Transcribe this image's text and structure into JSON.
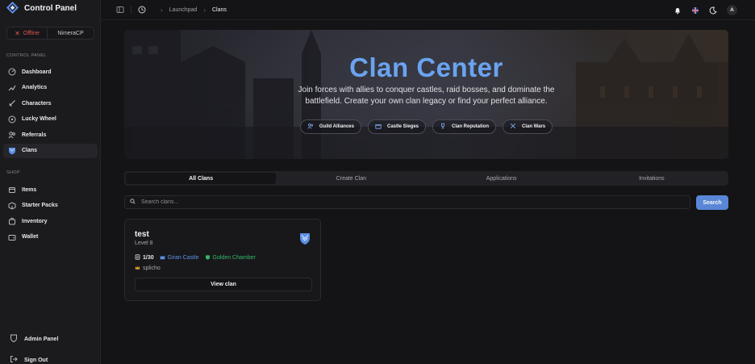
{
  "app": {
    "title": "Control Panel"
  },
  "server_status": {
    "status": "Offline",
    "server": "NimeraCP"
  },
  "sidebar": {
    "control_panel_label": "CONTROL PANEL",
    "control_items": [
      {
        "label": "Dashboard",
        "icon": "gauge-icon"
      },
      {
        "label": "Analytics",
        "icon": "chart-icon"
      },
      {
        "label": "Characters",
        "icon": "sword-icon"
      },
      {
        "label": "Lucky Wheel",
        "icon": "wheel-icon"
      },
      {
        "label": "Referrals",
        "icon": "referrals-icon"
      },
      {
        "label": "Clans",
        "icon": "shield-icon",
        "active": true
      }
    ],
    "shop_label": "SHOP",
    "shop_items": [
      {
        "label": "Items",
        "icon": "items-icon"
      },
      {
        "label": "Starter Packs",
        "icon": "package-icon"
      },
      {
        "label": "Inventory",
        "icon": "inventory-icon"
      },
      {
        "label": "Wallet",
        "icon": "wallet-icon"
      }
    ],
    "admin_panel": "Admin Panel",
    "sign_out": "Sign Out"
  },
  "header": {
    "breadcrumb": [
      "Launchpad",
      "Clans"
    ],
    "avatar_initial": "A"
  },
  "hero": {
    "title": "Clan Center",
    "subtitle": "Join forces with allies to conquer castles, raid bosses, and dominate the battlefield. Create your own clan legacy or find your perfect alliance.",
    "features": [
      "Guild Alliances",
      "Castle Sieges",
      "Clan Reputation",
      "Clan Wars"
    ]
  },
  "tabs": [
    "All Clans",
    "Create Clan",
    "Applications",
    "Invitations"
  ],
  "search": {
    "placeholder": "Search clans...",
    "button": "Search"
  },
  "clans": [
    {
      "name": "test",
      "level": "Level 8",
      "members": "1/30",
      "castle": "Giran Castle",
      "hall": "Golden Chamber",
      "leader": "splicho",
      "view_label": "View clan"
    }
  ],
  "colors": {
    "accent": "#6aa3f0",
    "button": "#5a86d6",
    "offline": "#e0564f",
    "castle_link": "#5b92e5",
    "hall_link": "#35b86a"
  }
}
